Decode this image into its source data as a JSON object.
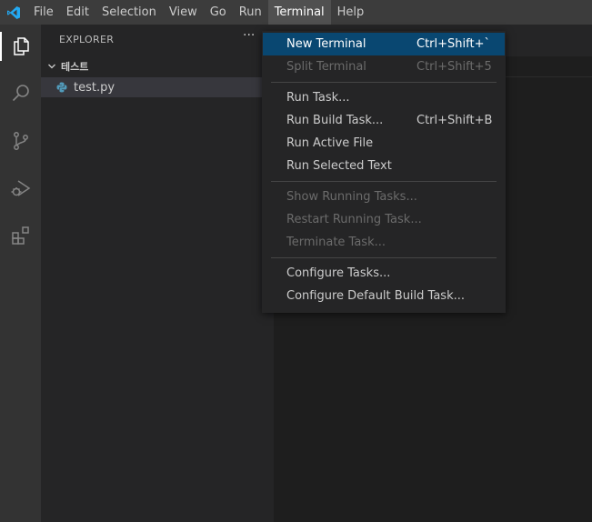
{
  "menubar": {
    "items": [
      {
        "label": "File"
      },
      {
        "label": "Edit"
      },
      {
        "label": "Selection"
      },
      {
        "label": "View"
      },
      {
        "label": "Go"
      },
      {
        "label": "Run"
      },
      {
        "label": "Terminal"
      },
      {
        "label": "Help"
      }
    ],
    "open_menu": "Terminal"
  },
  "activitybar": {
    "icons": [
      "explorer-icon",
      "search-icon",
      "source-control-icon",
      "run-debug-icon",
      "extensions-icon"
    ]
  },
  "sidebar": {
    "title": "EXPLORER",
    "more": "···",
    "folder": "테스트",
    "file": "test.py"
  },
  "terminal_menu": {
    "groups": [
      [
        {
          "label": "New Terminal",
          "keys": "Ctrl+Shift+`",
          "state": "highlight"
        },
        {
          "label": "Split Terminal",
          "keys": "Ctrl+Shift+5",
          "state": "disabled"
        }
      ],
      [
        {
          "label": "Run Task...",
          "keys": "",
          "state": "enabled"
        },
        {
          "label": "Run Build Task...",
          "keys": "Ctrl+Shift+B",
          "state": "enabled"
        },
        {
          "label": "Run Active File",
          "keys": "",
          "state": "enabled"
        },
        {
          "label": "Run Selected Text",
          "keys": "",
          "state": "enabled"
        }
      ],
      [
        {
          "label": "Show Running Tasks...",
          "keys": "",
          "state": "disabled"
        },
        {
          "label": "Restart Running Task...",
          "keys": "",
          "state": "disabled"
        },
        {
          "label": "Terminate Task...",
          "keys": "",
          "state": "disabled"
        }
      ],
      [
        {
          "label": "Configure Tasks...",
          "keys": "",
          "state": "enabled"
        },
        {
          "label": "Configure Default Build Task...",
          "keys": "",
          "state": "enabled"
        }
      ]
    ]
  },
  "colors": {
    "accent": "#094771",
    "vscode_blue": "#23a9f2",
    "python_blue": "#519aba"
  }
}
